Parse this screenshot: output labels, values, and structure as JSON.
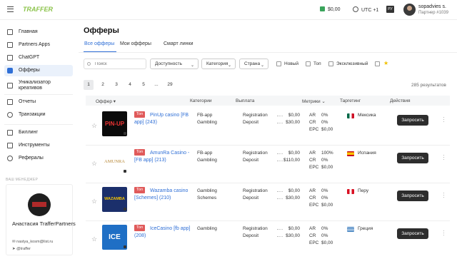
{
  "header": {
    "logo": "TRAFFER",
    "balance": "$0,00",
    "timezone": "UTC +1",
    "language": "РУ",
    "user_name": "sopadvies s.",
    "user_partner": "Партнер #1039"
  },
  "sidebar": {
    "items": [
      {
        "label": "Главная",
        "icon": "grid-icon"
      },
      {
        "label": "Partners Apps",
        "icon": "apps-icon"
      },
      {
        "label": "ChatGPT",
        "icon": "chat-icon"
      },
      {
        "label": "Офферы",
        "icon": "tag-icon"
      },
      {
        "label": "Уникализатор креативов",
        "icon": "image-icon"
      },
      {
        "label": "Отчеты",
        "icon": "chart-icon"
      },
      {
        "label": "Транзакции",
        "icon": "refresh-icon"
      },
      {
        "label": "Биллинг",
        "icon": "card-icon"
      },
      {
        "label": "Инструменты",
        "icon": "wrench-icon"
      },
      {
        "label": "Рефералы",
        "icon": "users-icon"
      }
    ],
    "manager_title": "ВАШ МЕНЕДЖЕР",
    "manager_name": "Анастасия TrafferPartners",
    "manager_email": "nastya_kosm@list.ru",
    "manager_telegram": "@traffer"
  },
  "main": {
    "title": "Офферы",
    "tabs": [
      "Все офферы",
      "Мои офферы",
      "Смарт линки"
    ],
    "filters": {
      "search_placeholder": "Поиск",
      "selects": [
        "Доступность",
        "Категория",
        "Страна"
      ],
      "checkboxes": [
        "Новый",
        "Топ",
        "Эксклюзивный"
      ]
    },
    "pagination": [
      "1",
      "2",
      "3",
      "4",
      "5",
      "...",
      "29"
    ],
    "results": "285  результатов",
    "columns": [
      "Оффер",
      "Категории",
      "Выплата",
      "Метрики",
      "Таргетинг",
      "Действия"
    ],
    "badge_top": "Топ",
    "request_label": "Запросить",
    "rows": [
      {
        "logo_text": "PIN-UP",
        "name": "PinUp casino [FB app] (243)",
        "categories": [
          "FB-app",
          "Gambling"
        ],
        "pay_labels": [
          "Registration",
          "Deposit"
        ],
        "pay_values": [
          "$0,00",
          "$30,00"
        ],
        "metrics": [
          [
            "AR",
            "0%"
          ],
          [
            "CR",
            "0%"
          ],
          [
            "EPC",
            "$0,00"
          ]
        ],
        "country": "Мексика"
      },
      {
        "logo_text": "AMUNRA",
        "name": "AmunRa Casino - [FB app] (213)",
        "categories": [
          "FB-app",
          "Gambling"
        ],
        "pay_labels": [
          "Registration",
          "Deposit"
        ],
        "pay_values": [
          "$0,00",
          "$110,00"
        ],
        "metrics": [
          [
            "AR",
            "100%"
          ],
          [
            "CR",
            "0%"
          ],
          [
            "EPC",
            "$0,00"
          ]
        ],
        "country": "Испания"
      },
      {
        "logo_text": "WAZAMBA",
        "name": "Wazamba casino [Schemes] (210)",
        "categories": [
          "Gambling",
          "Schemes"
        ],
        "pay_labels": [
          "Registration",
          "Deposit"
        ],
        "pay_values": [
          "$0,00",
          "$30,00"
        ],
        "metrics": [
          [
            "AR",
            "0%"
          ],
          [
            "CR",
            "0%"
          ],
          [
            "EPC",
            "$0,00"
          ]
        ],
        "country": "Перу"
      },
      {
        "logo_text": "ICE",
        "name": "IceCasino [fb app] (208)",
        "categories": [
          "Gambling"
        ],
        "pay_labels": [
          "Registration",
          "Deposit"
        ],
        "pay_values": [
          "$0,00",
          "$30,00"
        ],
        "metrics": [
          [
            "AR",
            "0%"
          ],
          [
            "CR",
            "0%"
          ],
          [
            "EPC",
            "$0,00"
          ]
        ],
        "country": "Греция"
      }
    ]
  },
  "colors": {
    "accent": "#2f6fd6",
    "logo_green": "#8bc34a",
    "badge_red": "#e05a5a",
    "button_dark": "#2d2d2d"
  }
}
